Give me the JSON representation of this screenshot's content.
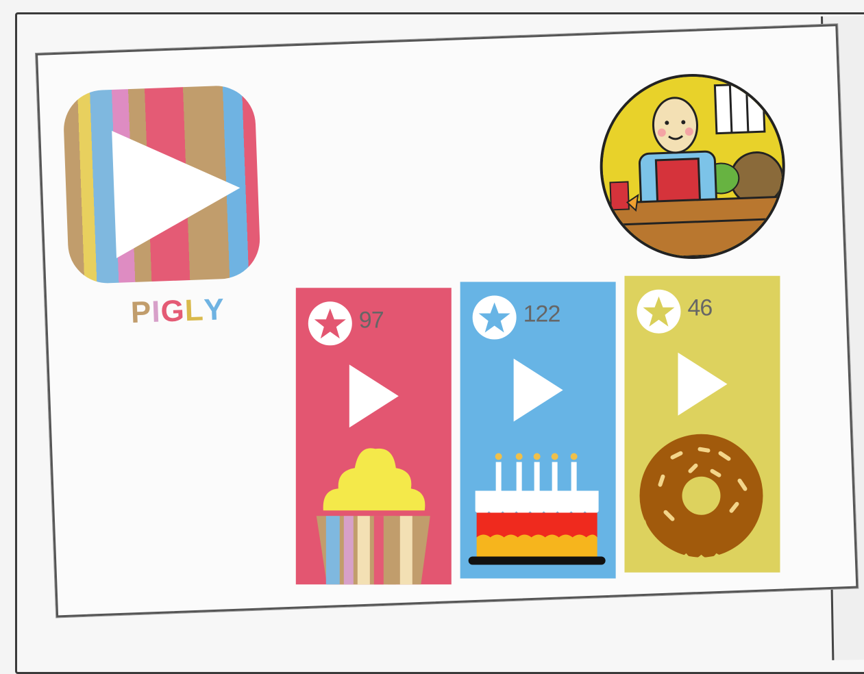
{
  "app": {
    "name": "PIGLY",
    "name_letters": [
      {
        "char": "P",
        "color": "#c19d6c"
      },
      {
        "char": "I",
        "color": "#d7a0c9"
      },
      {
        "char": "G",
        "color": "#e45b75"
      },
      {
        "char": "L",
        "color": "#d9b94c"
      },
      {
        "char": "Y",
        "color": "#6fb3e2"
      }
    ]
  },
  "profile": {
    "avatar": "shopkeeper-avatar"
  },
  "videos": [
    {
      "rating": "97",
      "color": "#e35671",
      "star_color": "#e35671",
      "thumbnail": "cupcake-icon"
    },
    {
      "rating": "122",
      "color": "#67b4e5",
      "star_color": "#67b4e5",
      "thumbnail": "birthday-cake-icon"
    },
    {
      "rating": "46",
      "color": "#ddd25e",
      "star_color": "#d9cf59",
      "thumbnail": "donut-icon"
    }
  ]
}
